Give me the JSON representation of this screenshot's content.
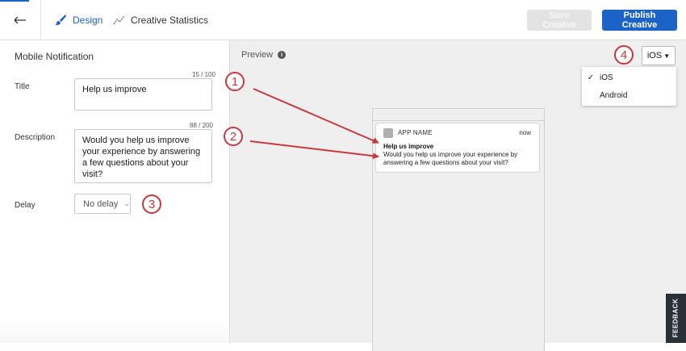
{
  "topbar": {
    "design_tab": "Design",
    "stats_tab": "Creative Statistics",
    "save_button": "Save Creative",
    "publish_button": "Publish Creative",
    "accent_color": "#1b63c6"
  },
  "form": {
    "panel_title": "Mobile Notification",
    "title_label": "Title",
    "title_counter": "15 / 100",
    "title_value": "Help us improve",
    "description_label": "Description",
    "description_counter": "88 / 200",
    "description_value": "Would you help us improve your experience by answering a few questions about your visit?",
    "delay_label": "Delay",
    "delay_value": "No delay"
  },
  "preview": {
    "label": "Preview",
    "platform_selected": "iOS",
    "platform_options": [
      "iOS",
      "Android"
    ],
    "notification": {
      "app_name": "APP NAME",
      "time": "now",
      "title": "Help us improve",
      "body": "Would you help us improve your experience by answering a few questions about your visit?"
    }
  },
  "annotations": [
    "1",
    "2",
    "3",
    "4"
  ],
  "annotation_color": "#c9373f",
  "feedback_tab": "FEEDBACK"
}
